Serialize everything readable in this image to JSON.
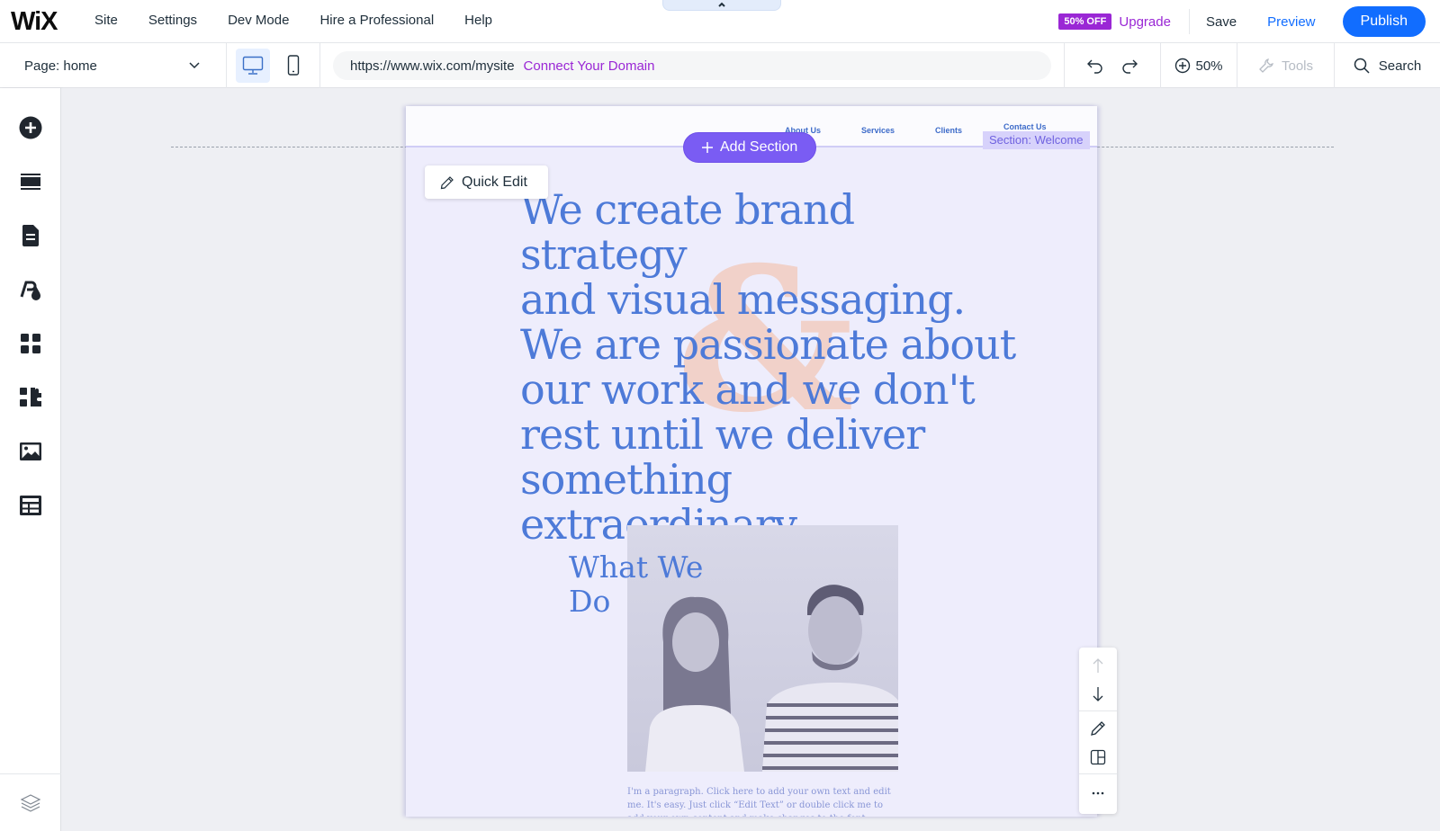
{
  "topbar": {
    "logo": "WiX",
    "menu": [
      {
        "label": "Site"
      },
      {
        "label": "Settings"
      },
      {
        "label": "Dev Mode"
      },
      {
        "label": "Hire a Professional"
      },
      {
        "label": "Help"
      }
    ],
    "badge": "50% OFF",
    "upgrade": "Upgrade",
    "save": "Save",
    "preview": "Preview",
    "publish": "Publish"
  },
  "secondbar": {
    "page_select": "Page: home",
    "url": "https://www.wix.com/mysite",
    "connect_domain": "Connect Your Domain",
    "zoom": "50%",
    "tools": "Tools",
    "search": "Search"
  },
  "sidebar": {
    "items": [
      {
        "name": "add-elements",
        "icon": "plus-circle-icon"
      },
      {
        "name": "add-section",
        "icon": "sections-icon"
      },
      {
        "name": "pages-menu",
        "icon": "page-icon"
      },
      {
        "name": "site-design",
        "icon": "theme-icon"
      },
      {
        "name": "add-apps",
        "icon": "apps-grid-icon"
      },
      {
        "name": "business-tools",
        "icon": "puzzle-icon"
      },
      {
        "name": "media",
        "icon": "image-icon"
      },
      {
        "name": "cms",
        "icon": "table-icon"
      }
    ],
    "bottom": {
      "name": "layers",
      "icon": "layers-icon"
    }
  },
  "site": {
    "nav": [
      "About Us",
      "Services",
      "Clients",
      "Contact Us"
    ],
    "section_label": "Section: Welcome",
    "add_section": "Add Section",
    "quick_edit": "Quick Edit",
    "hero_lines": [
      "We create brand strategy",
      "and visual messaging.",
      "We are passionate about",
      "our work and we don't",
      "rest until we deliver",
      "something extraordinary."
    ],
    "ampersand": "&",
    "what_we_do_lines": [
      "What We",
      "Do"
    ],
    "paragraph": "I'm a paragraph. Click here to add your own text and edit me. It's easy. Just click “Edit Text” or double click me to add your own content and make changes to the font."
  },
  "colors": {
    "accent": "#116dff",
    "upgrade": "#9a27d5",
    "add_section": "#7a5cf3",
    "hero_text": "#4d7ad8",
    "site_bg": "#eeedfc"
  }
}
